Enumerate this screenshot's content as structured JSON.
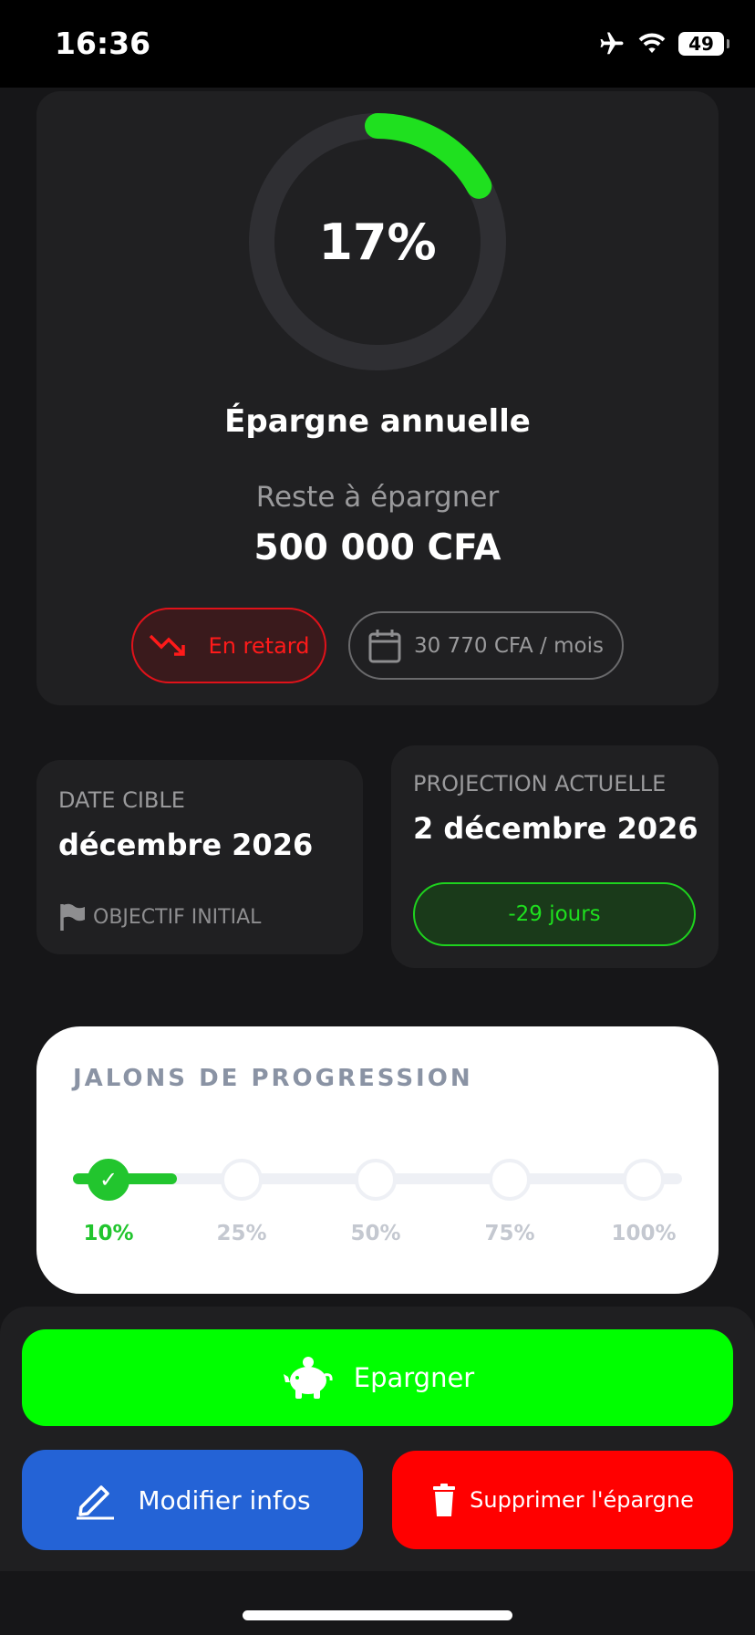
{
  "status_bar": {
    "time": "16:36",
    "battery": "49"
  },
  "savings": {
    "progress_percent_label": "17%",
    "progress_fraction": 0.17,
    "title": "Épargne annuelle",
    "remaining_label": "Reste à épargner",
    "remaining_amount": "500 000 CFA",
    "status_badge": "En retard",
    "monthly_badge": "30 770 CFA / mois"
  },
  "target_date": {
    "label": "DATE CIBLE",
    "value": "décembre 2026",
    "footnote": "OBJECTIF INITIAL"
  },
  "projection": {
    "label": "PROJECTION ACTUELLE",
    "value": "2 décembre 2026",
    "delta": "-29 jours"
  },
  "milestones": {
    "title": "JALONS DE PROGRESSION",
    "items": [
      {
        "label": "10%",
        "reached": true
      },
      {
        "label": "25%",
        "reached": false
      },
      {
        "label": "50%",
        "reached": false
      },
      {
        "label": "75%",
        "reached": false
      },
      {
        "label": "100%",
        "reached": false
      }
    ]
  },
  "actions": {
    "save_label": "Epargner",
    "edit_label": "Modifier infos",
    "delete_label": "Supprimer l'épargne"
  },
  "colors": {
    "accent_green": "#00ff00",
    "danger_red": "#ff0000",
    "edit_blue": "#2463d6",
    "card_bg": "#202022"
  }
}
